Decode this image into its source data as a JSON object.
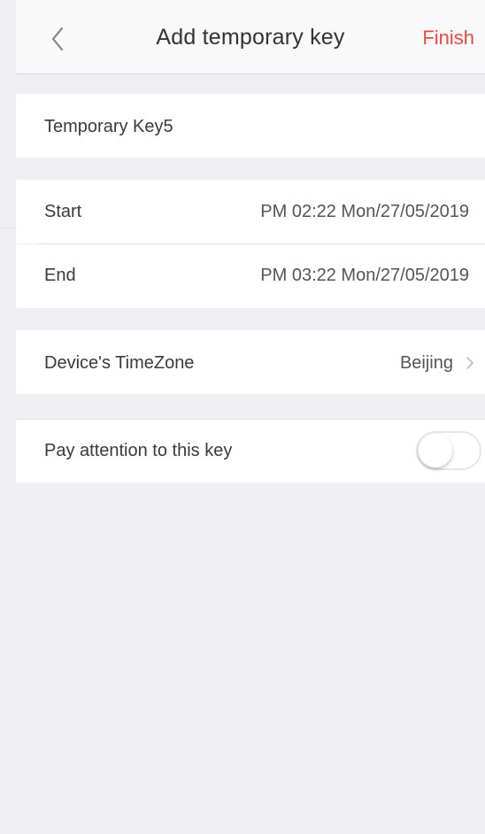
{
  "navbar": {
    "title": "Add temporary key",
    "back_icon": "chevron-left-icon",
    "finish_label": "Finish",
    "accent_color": "#e8483f"
  },
  "key_name": {
    "value": "Temporary Key5"
  },
  "schedule": {
    "start_label": "Start",
    "start_value": "PM 02:22 Mon/27/05/2019",
    "end_label": "End",
    "end_value": "PM 03:22 Mon/27/05/2019"
  },
  "timezone": {
    "label": "Device's TimeZone",
    "value": "Beijing",
    "chevron_icon": "chevron-right-icon"
  },
  "attention": {
    "label": "Pay attention to this key",
    "enabled": false
  }
}
